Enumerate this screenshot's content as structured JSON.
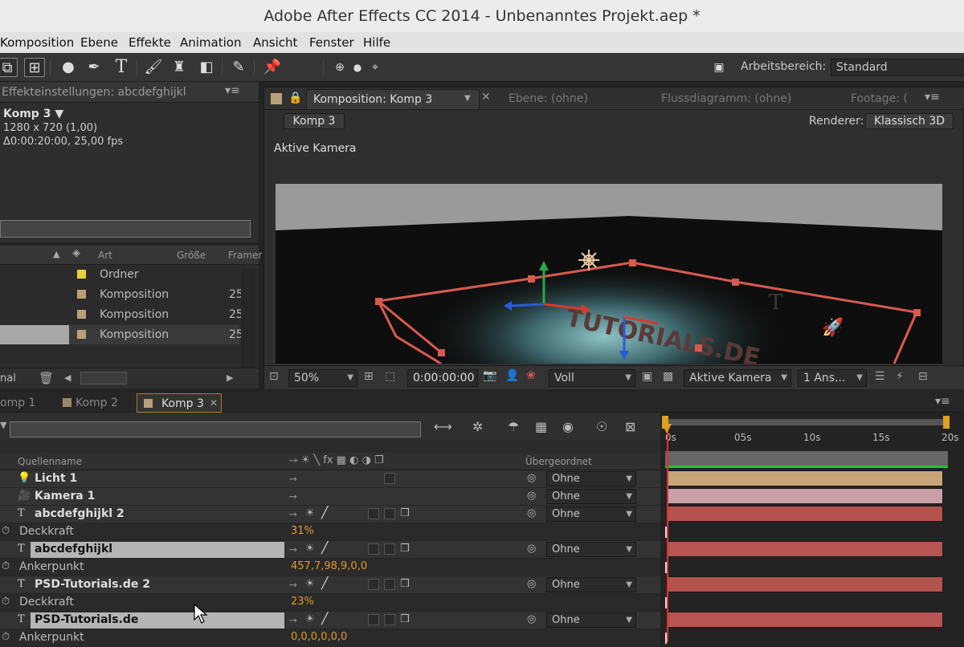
{
  "window": {
    "title": "Adobe After Effects CC 2014 - Unbenanntes Projekt.aep *"
  },
  "menu": [
    "Komposition",
    "Ebene",
    "Effekte",
    "Animation",
    "Ansicht",
    "Fenster",
    "Hilfe"
  ],
  "toolbar": {
    "workspace_label": "Arbeitsbereich:",
    "workspace_value": "Standard"
  },
  "effects_panel": {
    "tab": "Effekteinstellungen: abcdefghijkl",
    "comp_name": "Komp 3 ▼",
    "size": "1280 x 720 (1,00)",
    "duration": "Δ0:00:20:00, 25,00 fps"
  },
  "project": {
    "columns": {
      "art": "Art",
      "size": "Größe",
      "frame": "Framer"
    },
    "items": [
      {
        "type": "Ordner",
        "num": "",
        "color": "#e8cf3a"
      },
      {
        "type": "Komposition",
        "num": "25",
        "color": "#b9a07b"
      },
      {
        "type": "Komposition",
        "num": "25",
        "color": "#b9a07b"
      },
      {
        "type": "Komposition",
        "num": "25",
        "color": "#b9a07b"
      }
    ],
    "bottom_label": "nal"
  },
  "comp_viewer": {
    "tabs": {
      "komposition": "Komposition: Komp 3",
      "ebene": "Ebene: (ohne)",
      "fluss": "Flussdiagramm: (ohne)",
      "footage": "Footage: ("
    },
    "breadcrumb": "Komp 3",
    "renderer_label": "Renderer:",
    "renderer_value": "Klassisch 3D",
    "camera_label": "Aktive Kamera",
    "scene_text": "TUTORIALS.DE",
    "zoom": "50%",
    "timecode": "0:00:00:00",
    "resolution": "Voll",
    "view": "Aktive Kamera",
    "views": "1 Ans..."
  },
  "timeline": {
    "tabs": [
      "omp 1",
      "Komp 2",
      "Komp 3"
    ],
    "tab_colors": [
      "#9a8868",
      "#9a8868",
      "#b9a07b"
    ],
    "col_source": "Quellenname",
    "col_parent": "Übergeordnet",
    "ruler": [
      "0s",
      "05s",
      "10s",
      "15s",
      "20s"
    ],
    "rows": [
      {
        "kind": "main",
        "icon": "light",
        "name": "Licht 1",
        "parent": "Ohne",
        "bar": "#c6a478",
        "switches": "light"
      },
      {
        "kind": "main",
        "icon": "camera",
        "name": "Kamera 1",
        "parent": "Ohne",
        "bar": "#c9a0a6",
        "switches": "cam"
      },
      {
        "kind": "main",
        "icon": "text",
        "name": "abcdefghijkl 2",
        "parent": "Ohne",
        "bar": "#b4524e",
        "switches": "full"
      },
      {
        "kind": "sub",
        "name": "Deckkraft",
        "value": "31%"
      },
      {
        "kind": "main",
        "icon": "text",
        "name": "abcdefghijkl",
        "parent": "Ohne",
        "bar": "#b75652",
        "switches": "full",
        "selected": true
      },
      {
        "kind": "sub",
        "name": "Ankerpunkt",
        "value": "457,7,98,9,0,0"
      },
      {
        "kind": "main",
        "icon": "text",
        "name": "PSD-Tutorials.de 2",
        "parent": "Ohne",
        "bar": "#b4524e",
        "switches": "full"
      },
      {
        "kind": "sub",
        "name": "Deckkraft",
        "value": "23%"
      },
      {
        "kind": "main",
        "icon": "text",
        "name": "PSD-Tutorials.de",
        "parent": "Ohne",
        "bar": "#b75652",
        "switches": "full",
        "selected": true
      },
      {
        "kind": "sub",
        "name": "Ankerpunkt",
        "value": "0,0,0,0,0,0"
      }
    ]
  }
}
